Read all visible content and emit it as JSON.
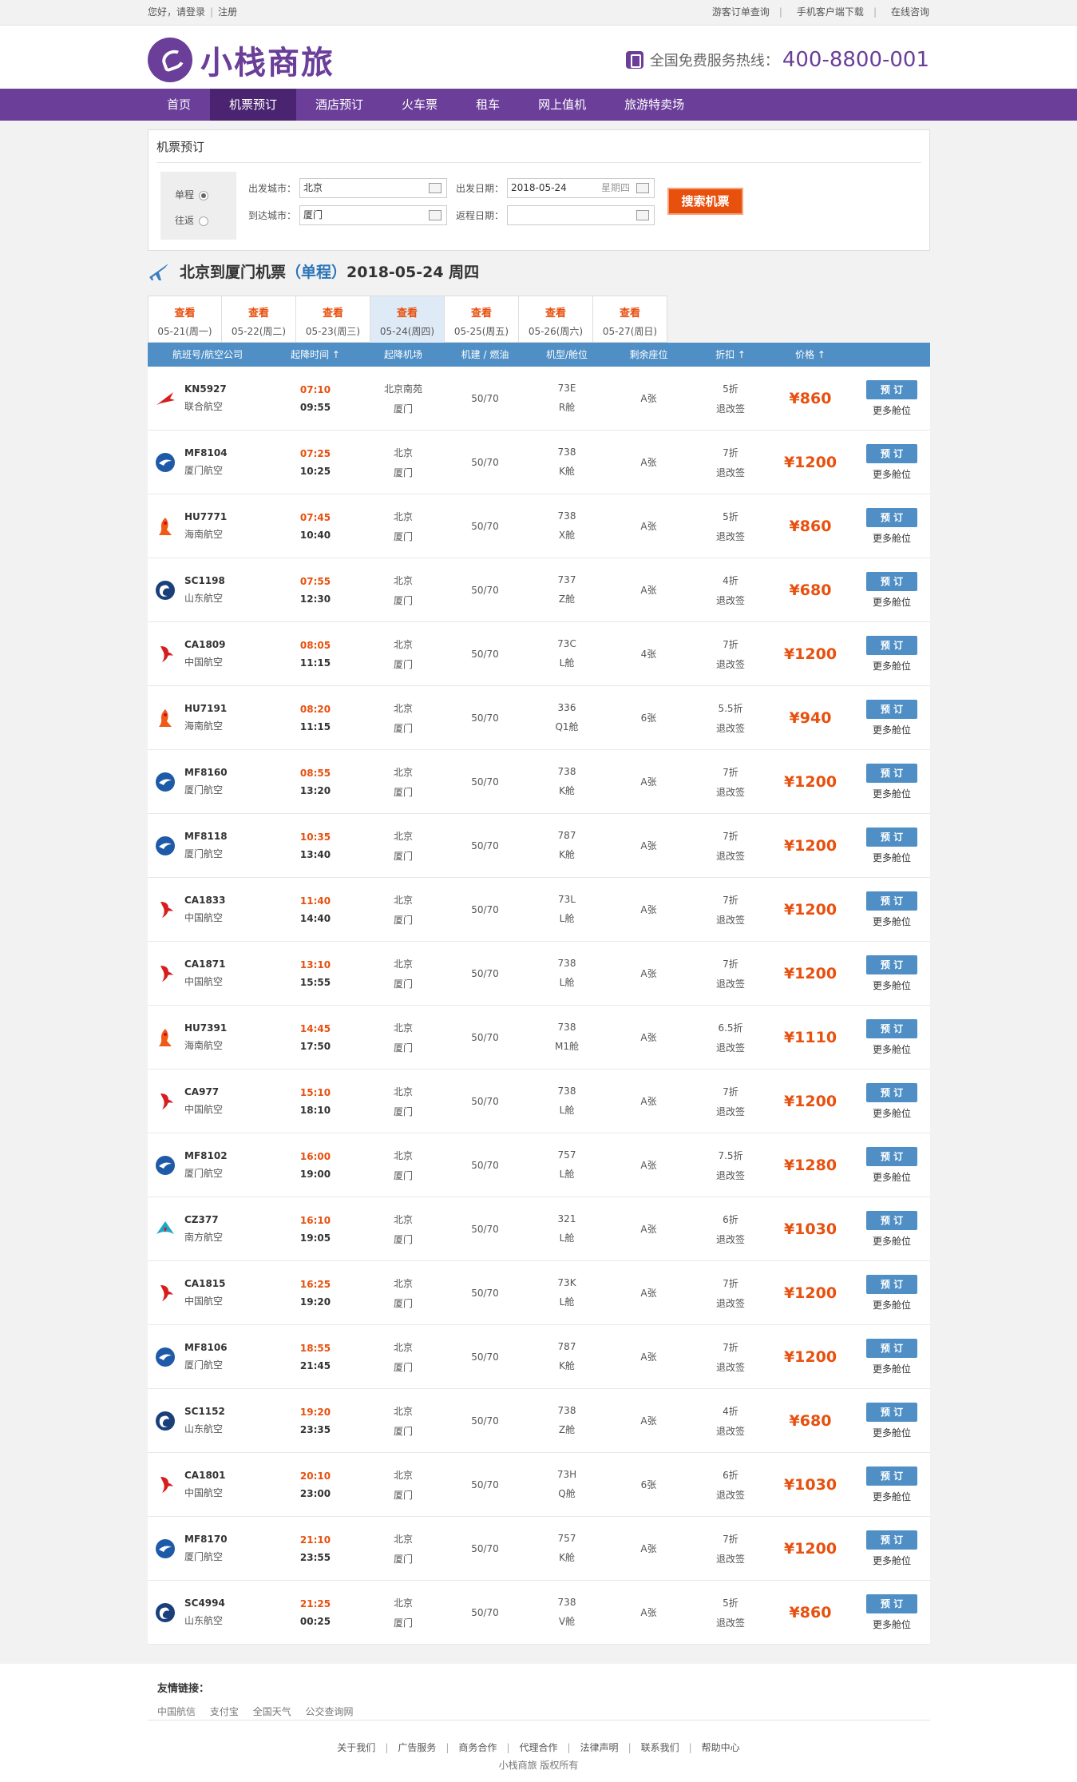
{
  "topbar": {
    "greeting": "您好，",
    "login": "请登录",
    "register": "注册",
    "links": [
      "游客订单查询",
      "手机客户端下载",
      "在线咨询"
    ]
  },
  "brand": {
    "name": "小栈商旅",
    "hotline_label": "全国免费服务热线：",
    "hotline_number": "400-8800-001",
    "primary_color": "#6a3e99"
  },
  "nav": {
    "items": [
      "首页",
      "机票预订",
      "酒店预订",
      "火车票",
      "租车",
      "网上值机",
      "旅游特卖场"
    ],
    "active": "机票预订"
  },
  "search": {
    "title": "机票预订",
    "one_way": "单程",
    "round_trip": "往返",
    "from_label": "出发城市：",
    "from_value": "北京",
    "to_label": "到达城市：",
    "to_value": "厦门",
    "depart_label": "出发日期：",
    "depart_value": "2018-05-24",
    "depart_weekday": "星期四",
    "return_label": "返程日期：",
    "return_value": "",
    "button": "搜索机票"
  },
  "result": {
    "title_prefix": "北京到厦门机票",
    "trip_type": "（单程）",
    "title_suffix": "2018-05-24 周四"
  },
  "date_tabs": [
    {
      "look": "查看",
      "date": "05-21(周一)"
    },
    {
      "look": "查看",
      "date": "05-22(周二)"
    },
    {
      "look": "查看",
      "date": "05-23(周三)"
    },
    {
      "look": "查看",
      "date": "05-24(周四)"
    },
    {
      "look": "查看",
      "date": "05-25(周五)"
    },
    {
      "look": "查看",
      "date": "05-26(周六)"
    },
    {
      "look": "查看",
      "date": "05-27(周日)"
    }
  ],
  "table": {
    "headers": [
      "航班号/航空公司",
      "起降时间 ↑",
      "起降机场",
      "机建 / 燃油",
      "机型/舱位",
      "剩余座位",
      "折扣 ↑",
      "价格 ↑"
    ],
    "book_label": "预 订",
    "more_label": "更多舱位",
    "rows": [
      {
        "airline": "kn",
        "flight": "KN5927",
        "company": "联合航空",
        "dep": "07:10",
        "arr": "09:55",
        "dep_ap": "北京南苑",
        "arr_ap": "厦门",
        "tax": "50/70",
        "model": "73E",
        "cabin": "R舱",
        "seats": "A张",
        "disc": "5折",
        "rule": "退改签",
        "price": "¥860"
      },
      {
        "airline": "mf",
        "flight": "MF8104",
        "company": "厦门航空",
        "dep": "07:25",
        "arr": "10:25",
        "dep_ap": "北京",
        "arr_ap": "厦门",
        "tax": "50/70",
        "model": "738",
        "cabin": "K舱",
        "seats": "A张",
        "disc": "7折",
        "rule": "退改签",
        "price": "¥1200"
      },
      {
        "airline": "hu",
        "flight": "HU7771",
        "company": "海南航空",
        "dep": "07:45",
        "arr": "10:40",
        "dep_ap": "北京",
        "arr_ap": "厦门",
        "tax": "50/70",
        "model": "738",
        "cabin": "X舱",
        "seats": "A张",
        "disc": "5折",
        "rule": "退改签",
        "price": "¥860"
      },
      {
        "airline": "sc",
        "flight": "SC1198",
        "company": "山东航空",
        "dep": "07:55",
        "arr": "12:30",
        "dep_ap": "北京",
        "arr_ap": "厦门",
        "tax": "50/70",
        "model": "737",
        "cabin": "Z舱",
        "seats": "A张",
        "disc": "4折",
        "rule": "退改签",
        "price": "¥680"
      },
      {
        "airline": "ca",
        "flight": "CA1809",
        "company": "中国航空",
        "dep": "08:05",
        "arr": "11:15",
        "dep_ap": "北京",
        "arr_ap": "厦门",
        "tax": "50/70",
        "model": "73C",
        "cabin": "L舱",
        "seats": "4张",
        "disc": "7折",
        "rule": "退改签",
        "price": "¥1200"
      },
      {
        "airline": "hu",
        "flight": "HU7191",
        "company": "海南航空",
        "dep": "08:20",
        "arr": "11:15",
        "dep_ap": "北京",
        "arr_ap": "厦门",
        "tax": "50/70",
        "model": "336",
        "cabin": "Q1舱",
        "seats": "6张",
        "disc": "5.5折",
        "rule": "退改签",
        "price": "¥940"
      },
      {
        "airline": "mf",
        "flight": "MF8160",
        "company": "厦门航空",
        "dep": "08:55",
        "arr": "13:20",
        "dep_ap": "北京",
        "arr_ap": "厦门",
        "tax": "50/70",
        "model": "738",
        "cabin": "K舱",
        "seats": "A张",
        "disc": "7折",
        "rule": "退改签",
        "price": "¥1200"
      },
      {
        "airline": "mf",
        "flight": "MF8118",
        "company": "厦门航空",
        "dep": "10:35",
        "arr": "13:40",
        "dep_ap": "北京",
        "arr_ap": "厦门",
        "tax": "50/70",
        "model": "787",
        "cabin": "K舱",
        "seats": "A张",
        "disc": "7折",
        "rule": "退改签",
        "price": "¥1200"
      },
      {
        "airline": "ca",
        "flight": "CA1833",
        "company": "中国航空",
        "dep": "11:40",
        "arr": "14:40",
        "dep_ap": "北京",
        "arr_ap": "厦门",
        "tax": "50/70",
        "model": "73L",
        "cabin": "L舱",
        "seats": "A张",
        "disc": "7折",
        "rule": "退改签",
        "price": "¥1200"
      },
      {
        "airline": "ca",
        "flight": "CA1871",
        "company": "中国航空",
        "dep": "13:10",
        "arr": "15:55",
        "dep_ap": "北京",
        "arr_ap": "厦门",
        "tax": "50/70",
        "model": "738",
        "cabin": "L舱",
        "seats": "A张",
        "disc": "7折",
        "rule": "退改签",
        "price": "¥1200"
      },
      {
        "airline": "hu",
        "flight": "HU7391",
        "company": "海南航空",
        "dep": "14:45",
        "arr": "17:50",
        "dep_ap": "北京",
        "arr_ap": "厦门",
        "tax": "50/70",
        "model": "738",
        "cabin": "M1舱",
        "seats": "A张",
        "disc": "6.5折",
        "rule": "退改签",
        "price": "¥1110"
      },
      {
        "airline": "ca",
        "flight": "CA977",
        "company": "中国航空",
        "dep": "15:10",
        "arr": "18:10",
        "dep_ap": "北京",
        "arr_ap": "厦门",
        "tax": "50/70",
        "model": "738",
        "cabin": "L舱",
        "seats": "A张",
        "disc": "7折",
        "rule": "退改签",
        "price": "¥1200"
      },
      {
        "airline": "mf",
        "flight": "MF8102",
        "company": "厦门航空",
        "dep": "16:00",
        "arr": "19:00",
        "dep_ap": "北京",
        "arr_ap": "厦门",
        "tax": "50/70",
        "model": "757",
        "cabin": "L舱",
        "seats": "A张",
        "disc": "7.5折",
        "rule": "退改签",
        "price": "¥1280"
      },
      {
        "airline": "cz",
        "flight": "CZ377",
        "company": "南方航空",
        "dep": "16:10",
        "arr": "19:05",
        "dep_ap": "北京",
        "arr_ap": "厦门",
        "tax": "50/70",
        "model": "321",
        "cabin": "L舱",
        "seats": "A张",
        "disc": "6折",
        "rule": "退改签",
        "price": "¥1030"
      },
      {
        "airline": "ca",
        "flight": "CA1815",
        "company": "中国航空",
        "dep": "16:25",
        "arr": "19:20",
        "dep_ap": "北京",
        "arr_ap": "厦门",
        "tax": "50/70",
        "model": "73K",
        "cabin": "L舱",
        "seats": "A张",
        "disc": "7折",
        "rule": "退改签",
        "price": "¥1200"
      },
      {
        "airline": "mf",
        "flight": "MF8106",
        "company": "厦门航空",
        "dep": "18:55",
        "arr": "21:45",
        "dep_ap": "北京",
        "arr_ap": "厦门",
        "tax": "50/70",
        "model": "787",
        "cabin": "K舱",
        "seats": "A张",
        "disc": "7折",
        "rule": "退改签",
        "price": "¥1200"
      },
      {
        "airline": "sc",
        "flight": "SC1152",
        "company": "山东航空",
        "dep": "19:20",
        "arr": "23:35",
        "dep_ap": "北京",
        "arr_ap": "厦门",
        "tax": "50/70",
        "model": "738",
        "cabin": "Z舱",
        "seats": "A张",
        "disc": "4折",
        "rule": "退改签",
        "price": "¥680"
      },
      {
        "airline": "ca",
        "flight": "CA1801",
        "company": "中国航空",
        "dep": "20:10",
        "arr": "23:00",
        "dep_ap": "北京",
        "arr_ap": "厦门",
        "tax": "50/70",
        "model": "73H",
        "cabin": "Q舱",
        "seats": "6张",
        "disc": "6折",
        "rule": "退改签",
        "price": "¥1030"
      },
      {
        "airline": "mf",
        "flight": "MF8170",
        "company": "厦门航空",
        "dep": "21:10",
        "arr": "23:55",
        "dep_ap": "北京",
        "arr_ap": "厦门",
        "tax": "50/70",
        "model": "757",
        "cabin": "K舱",
        "seats": "A张",
        "disc": "7折",
        "rule": "退改签",
        "price": "¥1200"
      },
      {
        "airline": "sc",
        "flight": "SC4994",
        "company": "山东航空",
        "dep": "21:25",
        "arr": "00:25",
        "dep_ap": "北京",
        "arr_ap": "厦门",
        "tax": "50/70",
        "model": "738",
        "cabin": "V舱",
        "seats": "A张",
        "disc": "5折",
        "rule": "退改签",
        "price": "¥860"
      }
    ]
  },
  "footer": {
    "friend_title": "友情链接：",
    "friend_links": [
      "中国航信",
      "支付宝",
      "全国天气",
      "公交查询网"
    ],
    "bottom_links": [
      "关于我们",
      "广告服务",
      "商务合作",
      "代理合作",
      "法律声明",
      "联系我们",
      "帮助中心"
    ],
    "copyright": "小栈商旅 版权所有"
  }
}
